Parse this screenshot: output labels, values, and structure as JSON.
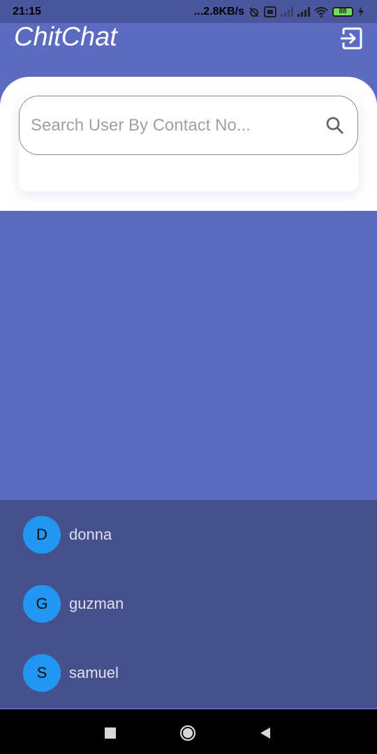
{
  "status_bar": {
    "time": "21:15",
    "network_speed": "...2.8KB/s",
    "battery_level": "88",
    "icons": [
      "alarm-off-icon",
      "volte-icon",
      "signal-icon",
      "signal-icon",
      "wifi-icon",
      "battery-icon",
      "charging-icon"
    ]
  },
  "app": {
    "title": "ChitChat",
    "logout_icon": "logout-icon",
    "colors": {
      "primary": "#5c6bc0",
      "list_bg": "#45508d",
      "avatar": "#2196f3"
    }
  },
  "search": {
    "placeholder": "Search User By Contact No...",
    "value": "",
    "icon": "search-icon"
  },
  "users": [
    {
      "initial": "D",
      "name": "donna"
    },
    {
      "initial": "G",
      "name": "guzman"
    },
    {
      "initial": "S",
      "name": "samuel"
    }
  ],
  "nav_bar": {
    "icons": [
      "recents-icon",
      "home-icon",
      "back-icon"
    ]
  }
}
